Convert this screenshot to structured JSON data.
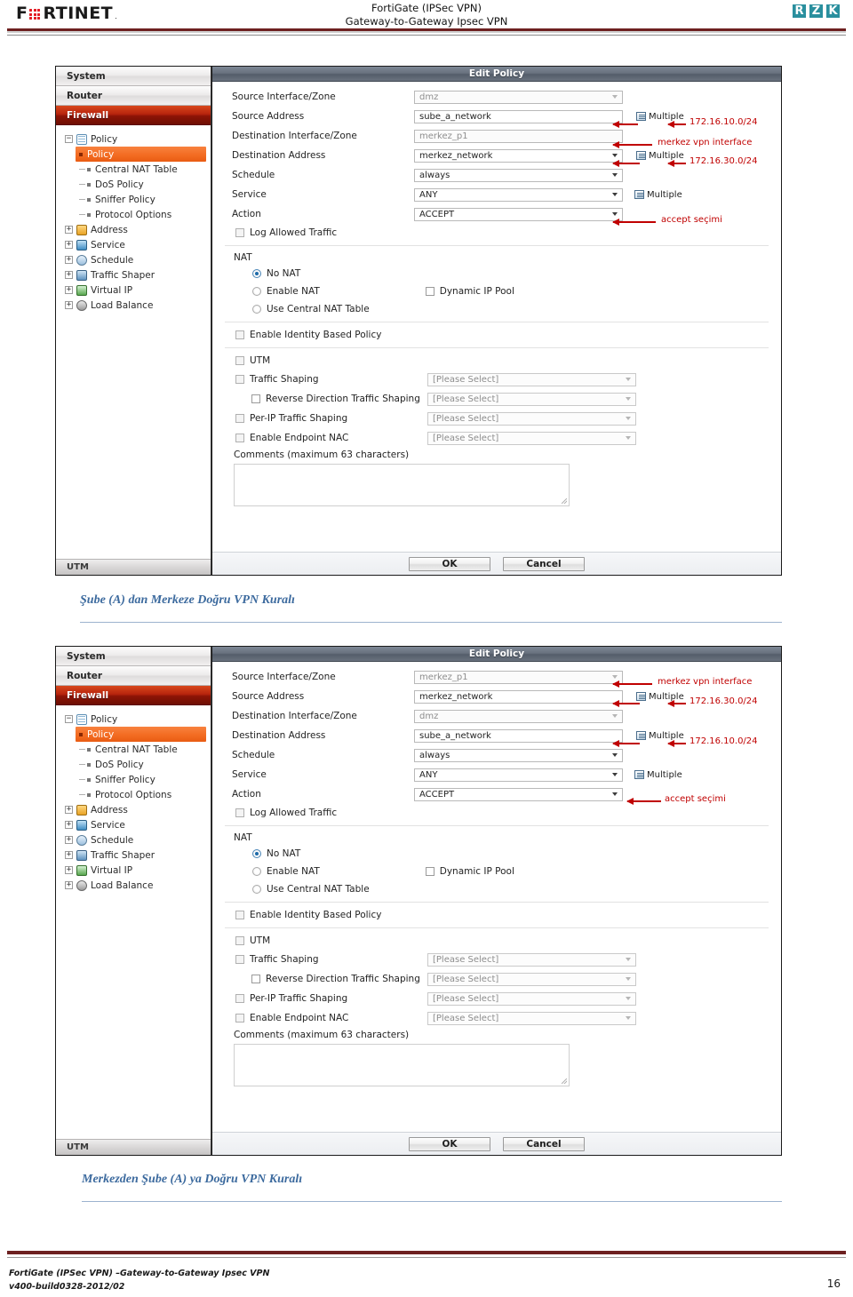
{
  "header": {
    "brand_logo": "fortinet-logo",
    "brand_text": "FORTINET",
    "title_line1": "FortiGate (IPSec VPN)",
    "title_line2": "Gateway-to-Gateway Ipsec VPN",
    "right_logo_letters": [
      "R",
      "Z",
      "K"
    ],
    "rule_color": "#6d2020",
    "accent_color": "#e31b23"
  },
  "sidebar": {
    "nav": [
      {
        "label": "System",
        "active": false
      },
      {
        "label": "Router",
        "active": false
      },
      {
        "label": "Firewall",
        "active": true
      }
    ],
    "tree": [
      {
        "label": "Policy",
        "type": "group",
        "icon": "policy-icon",
        "expander": "-"
      },
      {
        "label": "Policy",
        "type": "child",
        "selected": true
      },
      {
        "label": "Central NAT Table",
        "type": "child",
        "selected": false
      },
      {
        "label": "DoS Policy",
        "type": "child",
        "selected": false
      },
      {
        "label": "Sniffer Policy",
        "type": "child",
        "selected": false
      },
      {
        "label": "Protocol Options",
        "type": "child",
        "selected": false
      },
      {
        "label": "Address",
        "type": "group",
        "icon": "address-icon",
        "expander": "+"
      },
      {
        "label": "Service",
        "type": "group",
        "icon": "service-icon",
        "expander": "+"
      },
      {
        "label": "Schedule",
        "type": "group",
        "icon": "schedule-icon",
        "expander": "+"
      },
      {
        "label": "Traffic Shaper",
        "type": "group",
        "icon": "traffic-shaper-icon",
        "expander": "+"
      },
      {
        "label": "Virtual IP",
        "type": "group",
        "icon": "virtual-ip-icon",
        "expander": "+"
      },
      {
        "label": "Load Balance",
        "type": "group",
        "icon": "load-balance-icon",
        "expander": "+"
      }
    ],
    "footer_label": "UTM"
  },
  "dialog_common": {
    "title": "Edit Policy",
    "labels": {
      "source_iface": "Source Interface/Zone",
      "source_addr": "Source Address",
      "dest_iface": "Destination Interface/Zone",
      "dest_addr": "Destination Address",
      "schedule": "Schedule",
      "service": "Service",
      "action": "Action",
      "log_allowed": "Log Allowed Traffic",
      "nat": "NAT",
      "no_nat": "No NAT",
      "enable_nat": "Enable NAT",
      "dynamic_ip_pool": "Dynamic IP Pool",
      "use_central_nat": "Use Central NAT Table",
      "identity_policy": "Enable Identity Based Policy",
      "utm": "UTM",
      "traffic_shaping": "Traffic Shaping",
      "reverse_shaping": "Reverse Direction Traffic Shaping",
      "per_ip_shaping": "Per-IP Traffic Shaping",
      "endpoint_nac": "Enable Endpoint NAC",
      "comments": "Comments (maximum 63 characters)"
    },
    "values": {
      "schedule": "always",
      "service": "ANY",
      "action": "ACCEPT",
      "please_select": "[Please Select]",
      "multiple": "Multiple",
      "comments_value": ""
    },
    "buttons": {
      "ok": "OK",
      "cancel": "Cancel"
    },
    "annotation_color": "#c00000"
  },
  "shot1": {
    "source_iface": "dmz",
    "source_addr": "sube_a_network",
    "dest_iface": "merkez_p1",
    "dest_addr": "merkez_network",
    "ann_source_addr_net": "172.16.10.0/24",
    "ann_dest_iface": "merkez vpn interface",
    "ann_dest_addr_net": "172.16.30.0/24",
    "ann_action": "accept seçimi"
  },
  "caption1": "Şube (A) dan Merkeze Doğru VPN Kuralı",
  "shot2": {
    "source_iface": "merkez_p1",
    "source_addr": "merkez_network",
    "dest_iface": "dmz",
    "dest_addr": "sube_a_network",
    "ann_source_iface": "merkez vpn interface",
    "ann_source_addr_net": "172.16.30.0/24",
    "ann_dest_addr_net": "172.16.10.0/24",
    "ann_action": "accept seçimi"
  },
  "caption2": "Merkezden Şube (A) ya Doğru VPN Kuralı",
  "footer": {
    "line1": "FortiGate (IPSec VPN) –Gateway-to-Gateway Ipsec VPN",
    "line2": "v400-build0328-2012/02",
    "page_number": "16"
  }
}
